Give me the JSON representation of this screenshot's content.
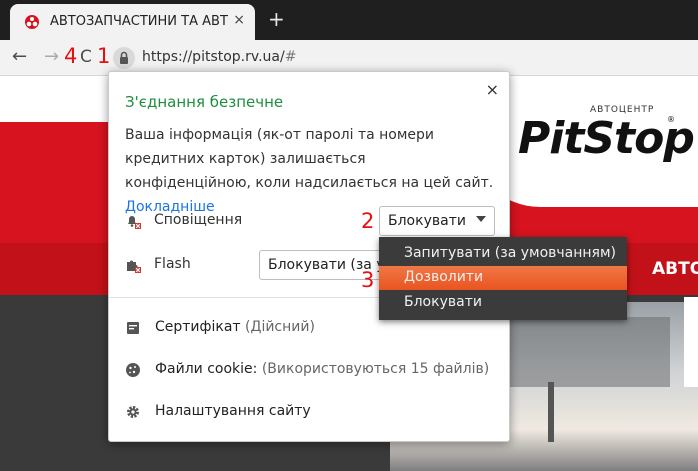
{
  "browser": {
    "tab_title": "АВТОЗАПЧАСТИНИ ТА АВТОСЕРВІС",
    "tab_close": "×",
    "new_tab": "+",
    "back": "←",
    "forward": "→",
    "reload": "C",
    "url_main": "https://pitstop.rv.ua/",
    "url_hash": "#"
  },
  "annotations": {
    "a1": "1",
    "a2": "2",
    "a3": "3",
    "a4": "4"
  },
  "page": {
    "brand_sub": "АВТОЦЕНТР",
    "brand": "PitStop",
    "brand_r": "®",
    "nav_text": "АВТО"
  },
  "popup": {
    "title": "З'єднання безпечне",
    "close": "×",
    "description": "Ваша інформація (як-от паролі та номери кредитних карток) залишається конфіденційною, коли надсилається на цей сайт.",
    "learn_more": "Докладніше",
    "permissions": [
      {
        "label": "Сповіщення",
        "value": "Блокувати"
      },
      {
        "label": "Flash",
        "value": "Блокувати (за умовчанням)"
      }
    ],
    "certificate": {
      "label": "Сертифікат",
      "status": "(Дійсний)"
    },
    "cookies": {
      "label": "Файли cookie:",
      "status": "(Використовуються 15 файлів)"
    },
    "site_settings": "Налаштування сайту"
  },
  "dropdown": {
    "options": [
      "Запитувати (за умовчанням)",
      "Дозволити",
      "Блокувати"
    ],
    "highlighted_index": 1
  },
  "colors": {
    "secure_green": "#1e8e3e",
    "link_blue": "#1a73e8",
    "highlight_orange": "#e95420",
    "brand_red": "#d6131f"
  }
}
